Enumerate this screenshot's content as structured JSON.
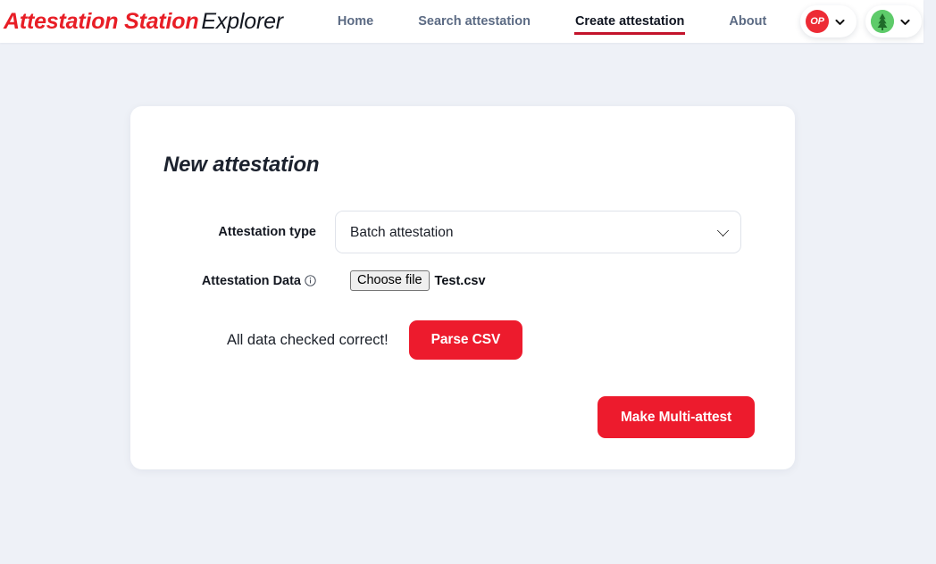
{
  "header": {
    "brand": {
      "primary": "Attestation Station",
      "secondary": "Explorer"
    },
    "nav": [
      {
        "label": "Home",
        "active": false
      },
      {
        "label": "Search attestation",
        "active": false
      },
      {
        "label": "Create attestation",
        "active": true
      },
      {
        "label": "About",
        "active": false
      }
    ],
    "network_badge": {
      "label": "OP",
      "icon": "chevron-down-icon",
      "color": "#ed2b35"
    },
    "account_badge": {
      "label": "",
      "icon": "chevron-down-icon",
      "avatar_icon": "tree-avatar-icon",
      "color": "#5ecb6a"
    }
  },
  "card": {
    "title": "New attestation",
    "attestation_type": {
      "label": "Attestation type",
      "value": "Batch attestation",
      "options": [
        "Batch attestation"
      ]
    },
    "attestation_data": {
      "label": "Attestation Data",
      "info_icon": "info-circle-icon",
      "choose_file_label": "Choose file",
      "file_name": "Test.csv"
    },
    "parse": {
      "status_text": "All data checked correct!",
      "button_label": "Parse CSV"
    },
    "submit": {
      "button_label": "Make Multi-attest"
    }
  },
  "colors": {
    "brand_red": "#e81e26",
    "button_red": "#ed1b2d",
    "active_underline": "#c3132b",
    "page_background": "#eef1f7",
    "nav_inactive": "#5c6b84"
  }
}
